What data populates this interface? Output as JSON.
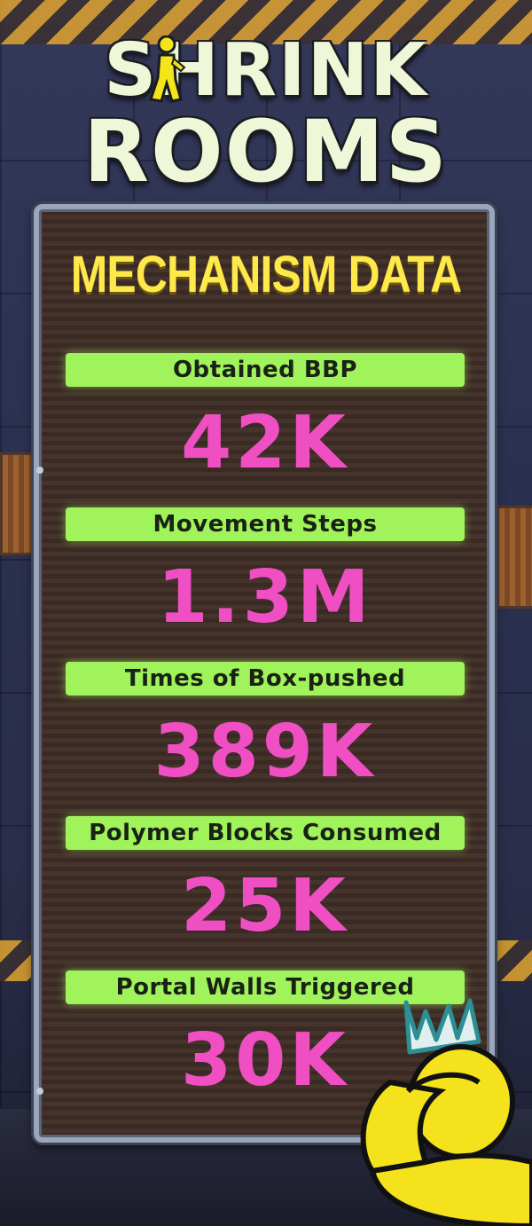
{
  "logo": {
    "line1": "SHRINK",
    "line2": "ROOMS"
  },
  "board": {
    "title": "MECHANISM DATA"
  },
  "stats": [
    {
      "label": "Obtained BBP",
      "value": "42K"
    },
    {
      "label": "Movement Steps",
      "value": "1.3M"
    },
    {
      "label": "Times of Box-pushed",
      "value": "389K"
    },
    {
      "label": "Polymer Blocks Consumed",
      "value": "25K"
    },
    {
      "label": "Portal Walls Triggered",
      "value": "30K"
    }
  ],
  "colors": {
    "label_bg": "#a0f35a",
    "value": "#f04fc4",
    "title": "#ffe84a",
    "logo": "#eef7d8",
    "board": "#3a2a24"
  }
}
